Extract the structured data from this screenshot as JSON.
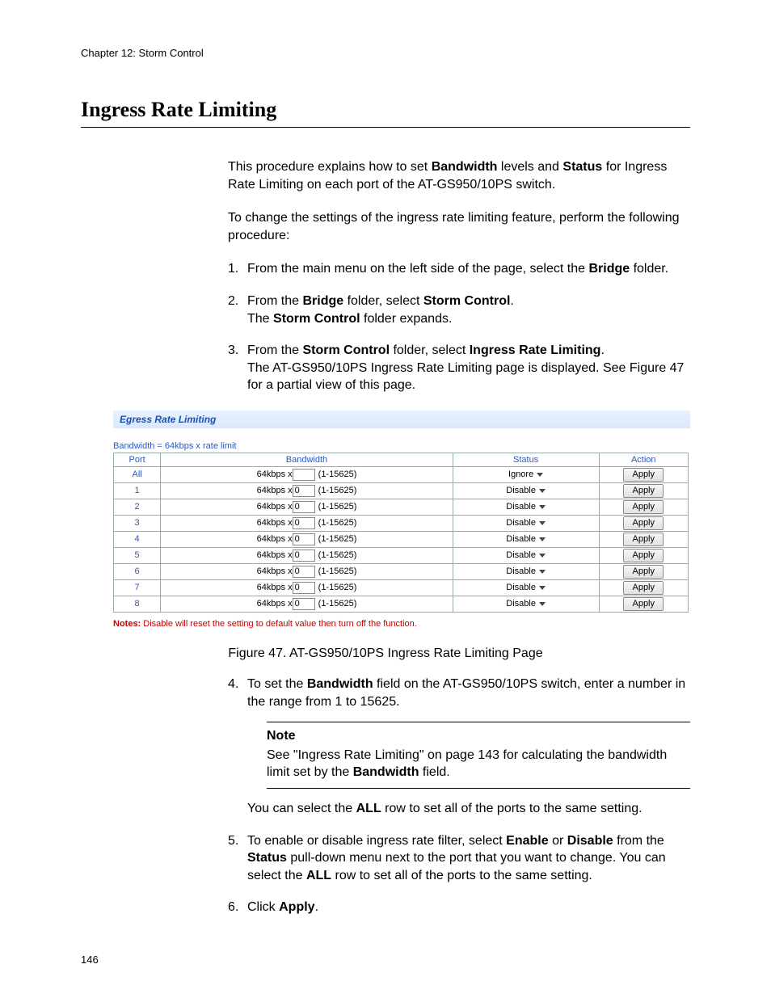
{
  "chapter_line": "Chapter 12: Storm Control",
  "section_title": "Ingress Rate Limiting",
  "page_number": "146",
  "intro": {
    "p1_a": "This procedure explains how to set ",
    "p1_b": "Bandwidth",
    "p1_c": " levels and ",
    "p1_d": "Status",
    "p1_e": " for Ingress Rate Limiting on each port of the AT-GS950/10PS switch.",
    "p2": "To change the settings of the ingress rate limiting feature, perform the following procedure:"
  },
  "steps_top": [
    {
      "num": "1.",
      "pre": "From the main menu on the left side of the page, select the ",
      "b1": "Bridge",
      "post": " folder."
    },
    {
      "num": "2.",
      "l1a": "From the ",
      "l1b": "Bridge",
      "l1c": " folder, select ",
      "l1d": "Storm Control",
      "l1e": ".",
      "l2a": "The ",
      "l2b": "Storm Control",
      "l2c": " folder expands."
    },
    {
      "num": "3.",
      "l1a": "From the ",
      "l1b": "Storm Control",
      "l1c": " folder, select ",
      "l1d": "Ingress Rate Limiting",
      "l1e": ".",
      "l2": "The AT-GS950/10PS Ingress Rate Limiting page is displayed. See Figure 47 for a partial view of this page."
    }
  ],
  "figure": {
    "barTitle": "Egress Rate Limiting",
    "sub": "Bandwidth = 64kbps x rate limit",
    "headers": {
      "port": "Port",
      "bw": "Bandwidth",
      "status": "Status",
      "action": "Action"
    },
    "bw_prefix": "64kbps x",
    "bw_range": "(1-15625)",
    "apply_label": "Apply",
    "rows": [
      {
        "port": "All",
        "val": "",
        "status": "Ignore"
      },
      {
        "port": "1",
        "val": "0",
        "status": "Disable"
      },
      {
        "port": "2",
        "val": "0",
        "status": "Disable"
      },
      {
        "port": "3",
        "val": "0",
        "status": "Disable"
      },
      {
        "port": "4",
        "val": "0",
        "status": "Disable"
      },
      {
        "port": "5",
        "val": "0",
        "status": "Disable"
      },
      {
        "port": "6",
        "val": "0",
        "status": "Disable"
      },
      {
        "port": "7",
        "val": "0",
        "status": "Disable"
      },
      {
        "port": "8",
        "val": "0",
        "status": "Disable"
      }
    ],
    "notes_a": "Notes:",
    "notes_b": " Disable will reset the setting to default value then turn off the function.",
    "caption": "Figure 47. AT-GS950/10PS Ingress Rate Limiting Page"
  },
  "step4": {
    "num": "4.",
    "a": "To set the ",
    "b": "Bandwidth",
    "c": " field on the AT-GS950/10PS switch, enter a number in the range from 1 to 15625."
  },
  "note": {
    "label": "Note",
    "a": "See \"Ingress Rate Limiting\" on page 143 for calculating the bandwidth limit set by the ",
    "b": "Bandwidth",
    "c": " field."
  },
  "after4": {
    "a": "You can select the ",
    "b": "ALL",
    "c": " row to set all of the ports to the same setting."
  },
  "step5": {
    "num": "5.",
    "a": "To enable or disable ingress rate filter, select ",
    "b": "Enable",
    "c": " or ",
    "d": "Disable",
    "e": " from the ",
    "f": "Status",
    "g": " pull-down menu next to the port that you want to change. You can select the ",
    "h": "ALL",
    "i": " row to set all of the ports to the same setting."
  },
  "step6": {
    "num": "6.",
    "a": "Click ",
    "b": "Apply",
    "c": "."
  }
}
